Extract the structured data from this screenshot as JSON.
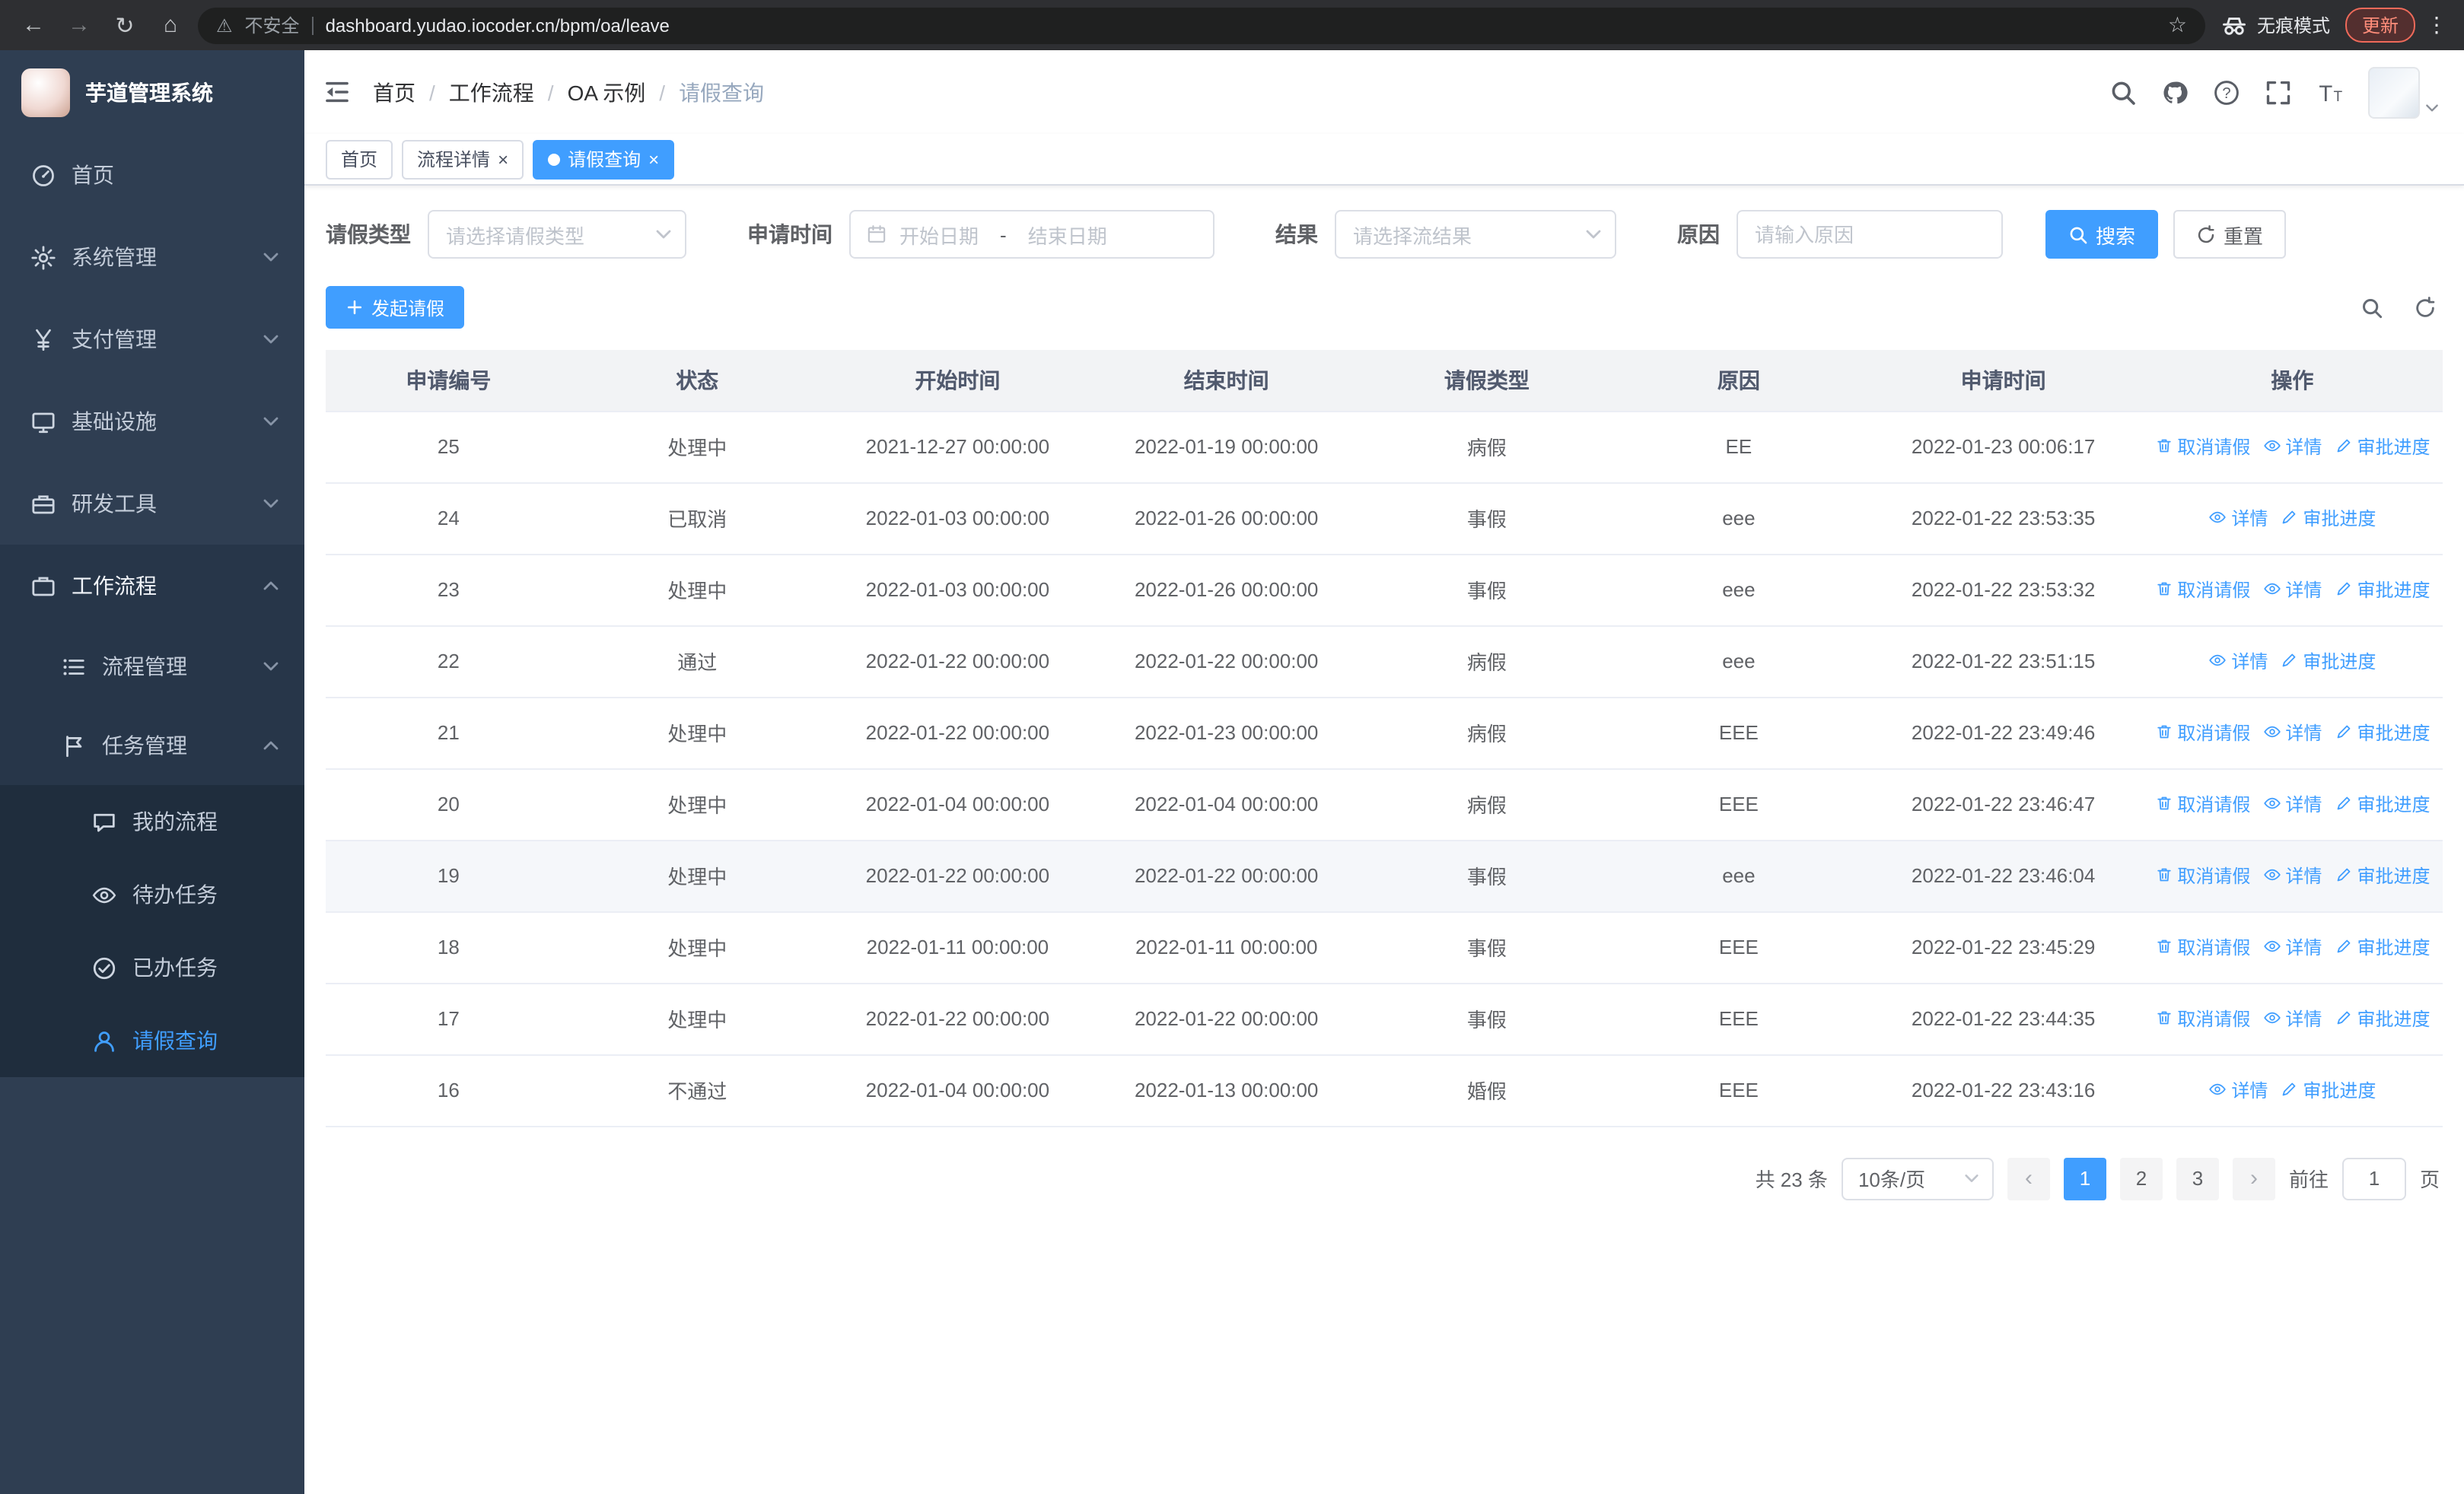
{
  "colors": {
    "accent": "#409eff",
    "sidebar_bg": "#2f3e52",
    "active_tab_bg": "#409eff"
  },
  "browser": {
    "warning": "不安全",
    "url": "dashboard.yudao.iocoder.cn/bpm/oa/leave",
    "incognito": "无痕模式",
    "update": "更新"
  },
  "sidebar": {
    "title": "芋道管理系统",
    "home": "首页",
    "system": "系统管理",
    "payment": "支付管理",
    "infra": "基础设施",
    "devtools": "研发工具",
    "workflow": "工作流程",
    "process_mgmt": "流程管理",
    "task_mgmt": "任务管理",
    "my_process": "我的流程",
    "todo_task": "待办任务",
    "done_task": "已办任务",
    "leave_query": "请假查询"
  },
  "header": {
    "breadcrumb": [
      "首页",
      "工作流程",
      "OA 示例",
      "请假查询"
    ]
  },
  "tabs": [
    {
      "label": "首页",
      "active": false,
      "closable": false
    },
    {
      "label": "流程详情",
      "active": false,
      "closable": true
    },
    {
      "label": "请假查询",
      "active": true,
      "closable": true
    }
  ],
  "filters": {
    "leave_type_label": "请假类型",
    "leave_type_placeholder": "请选择请假类型",
    "apply_time_label": "申请时间",
    "start_date_placeholder": "开始日期",
    "range_separator": "-",
    "end_date_placeholder": "结束日期",
    "result_label": "结果",
    "result_placeholder": "请选择流结果",
    "reason_label": "原因",
    "reason_placeholder": "请输入原因",
    "search_button": "搜索",
    "reset_button": "重置"
  },
  "toolbar": {
    "create_button": "发起请假"
  },
  "table": {
    "columns": [
      "申请编号",
      "状态",
      "开始时间",
      "结束时间",
      "请假类型",
      "原因",
      "申请时间",
      "操作"
    ],
    "action_labels": {
      "cancel": "取消请假",
      "detail": "详情",
      "progress": "审批进度"
    },
    "rows": [
      {
        "id": "25",
        "status": "处理中",
        "start": "2021-12-27 00:00:00",
        "end": "2022-01-19 00:00:00",
        "type": "病假",
        "reason": "EE",
        "applied": "2022-01-23 00:06:17"
      },
      {
        "id": "24",
        "status": "已取消",
        "start": "2022-01-03 00:00:00",
        "end": "2022-01-26 00:00:00",
        "type": "事假",
        "reason": "eee",
        "applied": "2022-01-22 23:53:35"
      },
      {
        "id": "23",
        "status": "处理中",
        "start": "2022-01-03 00:00:00",
        "end": "2022-01-26 00:00:00",
        "type": "事假",
        "reason": "eee",
        "applied": "2022-01-22 23:53:32"
      },
      {
        "id": "22",
        "status": "通过",
        "start": "2022-01-22 00:00:00",
        "end": "2022-01-22 00:00:00",
        "type": "病假",
        "reason": "eee",
        "applied": "2022-01-22 23:51:15"
      },
      {
        "id": "21",
        "status": "处理中",
        "start": "2022-01-22 00:00:00",
        "end": "2022-01-23 00:00:00",
        "type": "病假",
        "reason": "EEE",
        "applied": "2022-01-22 23:49:46"
      },
      {
        "id": "20",
        "status": "处理中",
        "start": "2022-01-04 00:00:00",
        "end": "2022-01-04 00:00:00",
        "type": "病假",
        "reason": "EEE",
        "applied": "2022-01-22 23:46:47"
      },
      {
        "id": "19",
        "status": "处理中",
        "start": "2022-01-22 00:00:00",
        "end": "2022-01-22 00:00:00",
        "type": "事假",
        "reason": "eee",
        "applied": "2022-01-22 23:46:04"
      },
      {
        "id": "18",
        "status": "处理中",
        "start": "2022-01-11 00:00:00",
        "end": "2022-01-11 00:00:00",
        "type": "事假",
        "reason": "EEE",
        "applied": "2022-01-22 23:45:29"
      },
      {
        "id": "17",
        "status": "处理中",
        "start": "2022-01-22 00:00:00",
        "end": "2022-01-22 00:00:00",
        "type": "事假",
        "reason": "EEE",
        "applied": "2022-01-22 23:44:35"
      },
      {
        "id": "16",
        "status": "不通过",
        "start": "2022-01-04 00:00:00",
        "end": "2022-01-13 00:00:00",
        "type": "婚假",
        "reason": "EEE",
        "applied": "2022-01-22 23:43:16"
      }
    ]
  },
  "pagination": {
    "total": "共 23 条",
    "page_size": "10条/页",
    "pages": [
      "1",
      "2",
      "3"
    ],
    "current_page": "1",
    "goto_label": "前往",
    "goto_value": "1",
    "goto_suffix": "页"
  }
}
